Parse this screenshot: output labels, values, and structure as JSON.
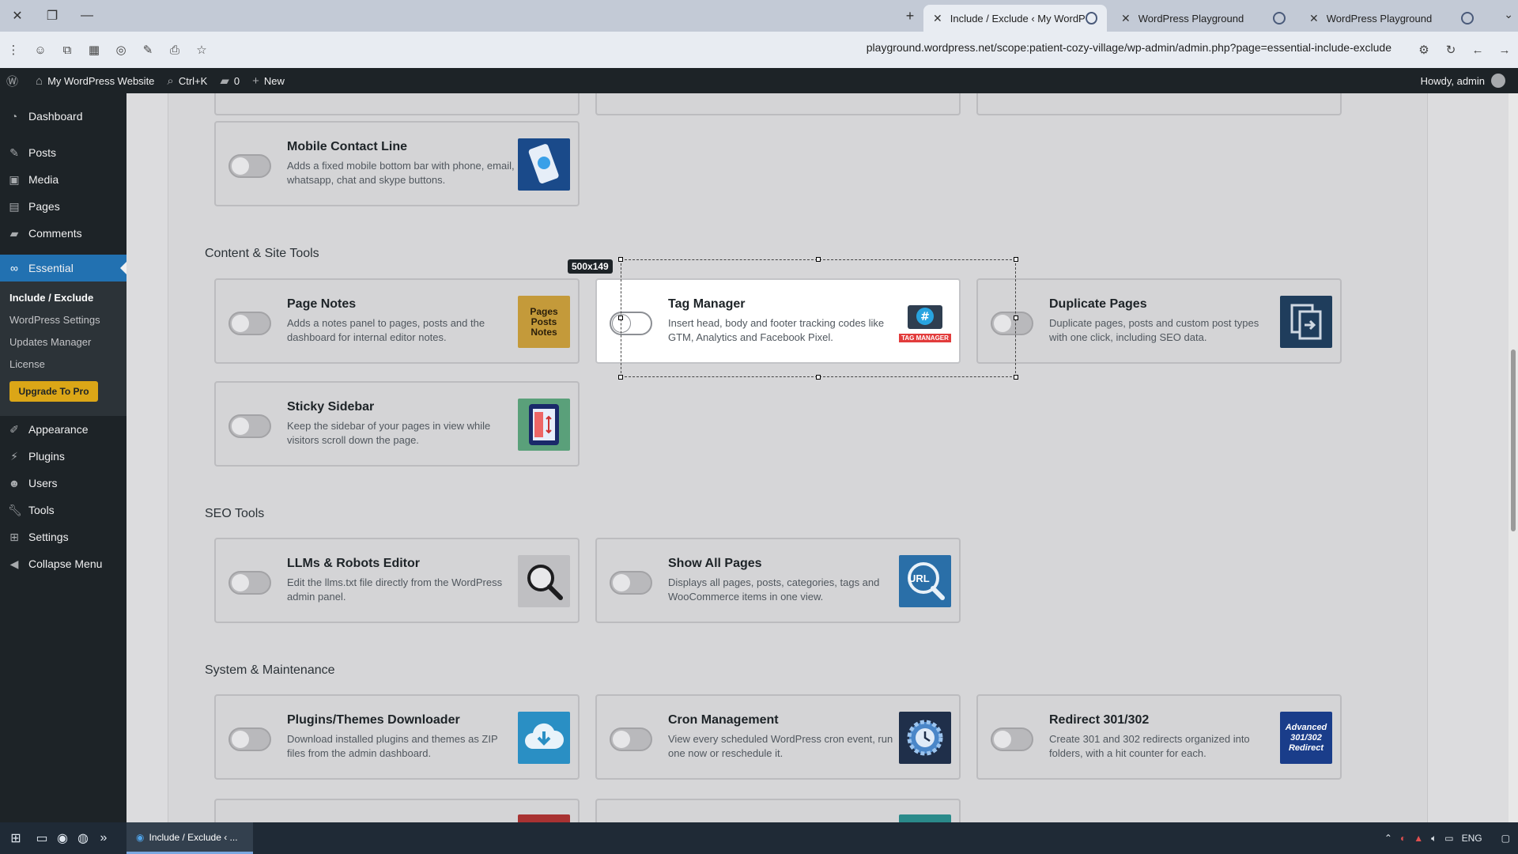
{
  "browser": {
    "tabs": [
      {
        "title": "Include / Exclude ‹ My WordPre",
        "active": true
      },
      {
        "title": "WordPress Playground",
        "active": false
      },
      {
        "title": "WordPress Playground",
        "active": false
      }
    ],
    "url": "playground.wordpress.net/scope:patient-cozy-village/wp-admin/admin.php?page=essential-include-exclude"
  },
  "adminbar": {
    "site_name": "My WordPress Website",
    "search_shortcut": "Ctrl+K",
    "comments_count": "0",
    "new_label": "New",
    "howdy": "Howdy, admin"
  },
  "sidebar": {
    "items_top": [
      {
        "label": "Dashboard",
        "icon": "dashboard-icon"
      },
      {
        "label": "Posts",
        "icon": "pin-icon"
      },
      {
        "label": "Media",
        "icon": "media-icon"
      },
      {
        "label": "Pages",
        "icon": "page-icon"
      },
      {
        "label": "Comments",
        "icon": "comment-icon"
      }
    ],
    "current": {
      "label": "Essential",
      "icon": "infinity-icon"
    },
    "submenu": [
      "Include / Exclude",
      "WordPress Settings",
      "Updates Manager",
      "License"
    ],
    "upgrade_label": "Upgrade To Pro",
    "items_bottom": [
      {
        "label": "Appearance",
        "icon": "brush-icon"
      },
      {
        "label": "Plugins",
        "icon": "plug-icon"
      },
      {
        "label": "Users",
        "icon": "user-icon"
      },
      {
        "label": "Tools",
        "icon": "wrench-icon"
      },
      {
        "label": "Settings",
        "icon": "settings-icon"
      },
      {
        "label": "Collapse Menu",
        "icon": "collapse-icon"
      }
    ]
  },
  "sections": {
    "content_tools": "Content & Site Tools",
    "seo_tools": "SEO Tools",
    "system_maintenance": "System & Maintenance"
  },
  "cards": {
    "mobile_contact": {
      "title": "Mobile Contact Line",
      "desc": "Adds a fixed mobile bottom bar with phone, email, whatsapp, chat and skype buttons."
    },
    "page_notes": {
      "title": "Page Notes",
      "desc": "Adds a notes panel to pages, posts and the dashboard for internal editor notes.",
      "img_text": "Pages Posts Notes"
    },
    "tag_manager": {
      "title": "Tag Manager",
      "desc": "Insert head, body and footer tracking codes like GTM, Analytics and Facebook Pixel.",
      "img_text": "TAG MANAGER"
    },
    "duplicate_pages": {
      "title": "Duplicate Pages",
      "desc": "Duplicate pages, posts and custom post types with one click, including SEO data."
    },
    "sticky_sidebar": {
      "title": "Sticky Sidebar",
      "desc": "Keep the sidebar of your pages in view while visitors scroll down the page."
    },
    "llms_robots": {
      "title": "LLMs & Robots Editor",
      "desc": "Edit the llms.txt file directly from the WordPress admin panel."
    },
    "show_all_pages": {
      "title": "Show All Pages",
      "desc": "Displays all pages, posts, categories, tags and WooCommerce items in one view.",
      "img_text": "URL"
    },
    "plugins_downloader": {
      "title": "Plugins/Themes Downloader",
      "desc": "Download installed plugins and themes as ZIP files from the admin dashboard."
    },
    "cron_management": {
      "title": "Cron Management",
      "desc": "View every scheduled WordPress cron event, run one now or reschedule it."
    },
    "redirect": {
      "title": "Redirect 301/302",
      "desc": "Create 301 and 302 redirects organized into folders, with a hit counter for each.",
      "img_text": "Advanced 301/302 Redirect"
    }
  },
  "selection_label": "500x149",
  "taskbar": {
    "app_label": "Include / Exclude ‹ ...",
    "lang": "ENG"
  }
}
